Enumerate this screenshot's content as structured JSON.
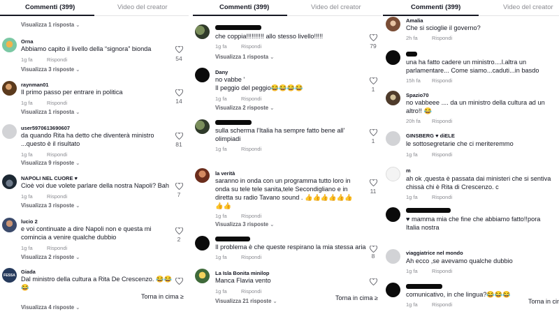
{
  "panels": [
    {
      "tabs": {
        "comments": "Commenti (399)",
        "creator": "Video del creator"
      },
      "top_view": "Visualizza 1 risposta",
      "comments": [
        {
          "name": "Orna",
          "text": [
            "Abbiamo capito il livello della “signora” bionda"
          ],
          "time": "1g fa",
          "reply": "Rispondi",
          "likes": "54",
          "view": "Visualizza 3 risposte"
        },
        {
          "name": "raynman01",
          "text": [
            "Il primo passo per entrare in politica"
          ],
          "time": "1g fa",
          "reply": "Rispondi",
          "likes": "14",
          "view": "Visualizza 1 risposta"
        },
        {
          "name": "user5970613690607",
          "text": [
            "da quando Rita ha detto che diventerà ministro",
            "...questo è il risultato"
          ],
          "time": "1g fa",
          "reply": "Rispondi",
          "likes": "81",
          "view": "Visualizza 9 risposte"
        },
        {
          "name": "NAPOLI NEL CUORE ♥",
          "text": [
            "Cioè voi due volete parlare della nostra Napoli? Bah"
          ],
          "time": "1g fa",
          "reply": "Rispondi",
          "likes": "7",
          "view": "Visualizza 3 risposte"
        },
        {
          "name": "lucio 2",
          "text": [
            "e voi continuate a dire Napoli non e questa mi",
            "comincia a venire qualche dubbio"
          ],
          "time": "1g fa",
          "reply": "Rispondi",
          "likes": "2",
          "view": "Visualizza 2 risposte"
        },
        {
          "name": "Giada",
          "text": [
            "Dal ministro della cultura a Rita De Crescenzo. 😂😂",
            "😂"
          ],
          "time": "1g fa",
          "reply": "Rispondi",
          "likes": "",
          "view": "Visualizza 4 risposte"
        }
      ],
      "back_to_top": "Torna in cima ≥"
    },
    {
      "tabs": {
        "comments": "Commenti (399)",
        "creator": "Video del creator"
      },
      "comments": [
        {
          "name": "",
          "text": [
            "che coppia!!!!!!!!!! allo stesso livello!!!!!"
          ],
          "time": "1g fa",
          "reply": "Rispondi",
          "likes": "79",
          "view": "Visualizza 1 risposta"
        },
        {
          "name": "Dany",
          "text": [
            "no vabbe '",
            "Il peggio del peggio😂😂😂😂"
          ],
          "time": "1g fa",
          "reply": "Rispondi",
          "likes": "1",
          "view": "Visualizza 2 risposte"
        },
        {
          "name": "",
          "text": [
            "sulla scherma l'Italia ha sempre fatto bene all'",
            "olimpiadi"
          ],
          "time": "1g fa",
          "reply": "Rispondi",
          "likes": "1",
          "view": ""
        },
        {
          "name": "la verità",
          "text": [
            "saranno in onda con un programma tutto loro in",
            "onda su tele tele sanita,tele Secondigliano e in",
            "diretta su radio Tavano sound . 👍👍👍👍👍👍",
            "👍👍"
          ],
          "time": "1g fa",
          "reply": "Rispondi",
          "likes": "11",
          "view": "Visualizza 3 risposte"
        },
        {
          "name": "",
          "text": [
            "Il problema è che queste respirano la mia stessa aria"
          ],
          "time": "1g fa",
          "reply": "Rispondi",
          "likes": "8",
          "view": ""
        },
        {
          "name": "La Isla Bonita minilop",
          "text": [
            "Manca Flavia vento"
          ],
          "time": "1g fa",
          "reply": "Rispondi",
          "likes": "",
          "view": "Visualizza 21 risposte"
        }
      ],
      "back_to_top": "Torna in cima ≥"
    },
    {
      "tabs": {
        "comments": "Commenti (399)",
        "creator": "Video del creator"
      },
      "comments": [
        {
          "name": "Amalia",
          "text": [
            "Che si scioglie il governo?"
          ],
          "time": "2h fa",
          "reply": "Rispondi",
          "likes": ""
        },
        {
          "name": "",
          "text": [
            "una ha fatto cadere un ministro....l.altra un",
            "parlamentare... Come siamo...caduti...in basdo"
          ],
          "time": "15h fa",
          "reply": "Rispondi",
          "likes": ""
        },
        {
          "name": "Spazio70",
          "text": [
            "no vabbeee .... da un ministro della cultura ad un",
            "altro!! 😂"
          ],
          "time": "20h fa",
          "reply": "Rispondi",
          "likes": ""
        },
        {
          "name": "GINSBERG ♥ diELE",
          "text": [
            "le sottosegretarie che ci meriteremmo"
          ],
          "time": "1g fa",
          "reply": "Rispondi",
          "likes": ""
        },
        {
          "name": "m",
          "text": [
            "ah ok ,questa è passata dai ministeri che si sentiva",
            "chissà chi è Rita di Crescenzo. c"
          ],
          "time": "1g fa",
          "reply": "Rispondi",
          "likes": ""
        },
        {
          "name": "",
          "text": [
            "♥ mamma mia che fine che abbiamo fatto!!pora",
            "Italia nostra"
          ],
          "time": "1g fa",
          "reply": "Rispondi",
          "likes": ""
        },
        {
          "name": "viaggiatrice nel mondo",
          "text": [
            "Ah ecco ,se avevamo qualche dubbio"
          ],
          "time": "1g fa",
          "reply": "Rispondi",
          "likes": ""
        },
        {
          "name": "",
          "text": [
            "comunicativo, in che lingua?😂😂😂"
          ],
          "time": "1g fa",
          "reply": "Rispondi",
          "likes": ""
        }
      ],
      "back_to_top": "Torna in cima"
    }
  ]
}
